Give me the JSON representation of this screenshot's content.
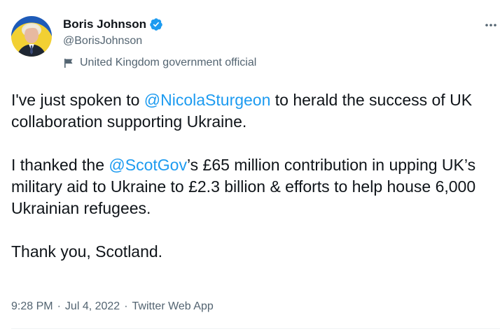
{
  "author": {
    "display_name": "Boris Johnson",
    "handle": "@BorisJohnson",
    "label": "United Kingdom government official"
  },
  "tweet": {
    "p1_a": "I've just spoken to ",
    "p1_mention": "@NicolaSturgeon",
    "p1_b": " to herald the success of UK collaboration supporting Ukraine.",
    "p2_a": "I thanked the ",
    "p2_mention": "@ScotGov",
    "p2_b": "’s £65 million contribution in upping UK’s military aid to Ukraine to £2.3 billion & efforts to help house 6,000 Ukrainian refugees.",
    "p3": "Thank you, Scotland."
  },
  "meta": {
    "time": "9:28 PM",
    "date": "Jul 4, 2022",
    "source": "Twitter Web App",
    "separator": "·"
  },
  "colors": {
    "link": "#1d9bf0",
    "secondary_text": "#536471",
    "primary_text": "#0f1419",
    "verified": "#1d9bf0"
  },
  "icons": {
    "verified": "verified-badge-icon",
    "label": "flag-icon",
    "more": "more-icon"
  }
}
